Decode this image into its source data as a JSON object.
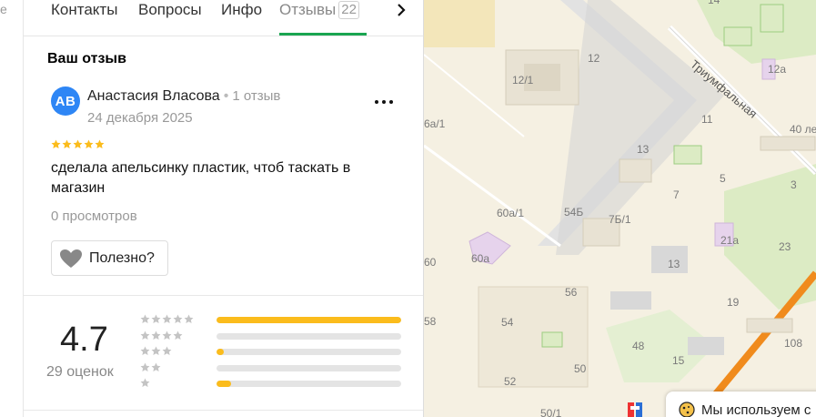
{
  "left_fragment": "е",
  "tabs": [
    {
      "label": "Контакты"
    },
    {
      "label": "Вопросы"
    },
    {
      "label": "Инфо"
    },
    {
      "label": "Отзывы",
      "badge": "22"
    }
  ],
  "my_review": {
    "section_title": "Ваш отзыв",
    "avatar_initials": "АВ",
    "author": "Анастасия Власова",
    "author_meta": "1 отзыв",
    "date": "24 декабря 2025",
    "stars": 5,
    "text": "сделала апельсинку пластик, чтоб таскать в магазин",
    "views": "0 просмотров",
    "useful_label": "Полезно?"
  },
  "rating_summary": {
    "value": "4.7",
    "count_label": "29 оценок",
    "distribution": [
      {
        "stars": 5,
        "fraction": 1.0
      },
      {
        "stars": 4,
        "fraction": 0.0
      },
      {
        "stars": 3,
        "fraction": 0.04
      },
      {
        "stars": 2,
        "fraction": 0.0
      },
      {
        "stars": 1,
        "fraction": 0.08
      }
    ]
  },
  "map": {
    "street_label": "Триумфальная",
    "labels": [
      "12",
      "12/1",
      "14",
      "12а",
      "11",
      "40 ле",
      "13",
      "5",
      "3",
      "7",
      "6а/1",
      "60а/1",
      "54Б",
      "7Б/1",
      "21а",
      "23",
      "60а",
      "13",
      "60",
      "56",
      "19",
      "58",
      "54",
      "48",
      "108",
      "50",
      "15",
      "52",
      "50/1"
    ],
    "cookie_text": "Мы используем с"
  },
  "colors": {
    "accent_green": "#1aa551",
    "star_yellow": "#fbbc1c",
    "avatar_blue": "#2e86f5",
    "map_bg": "#f5f0e2",
    "map_green": "#dcebc4",
    "road_orange": "#f08b1d"
  }
}
